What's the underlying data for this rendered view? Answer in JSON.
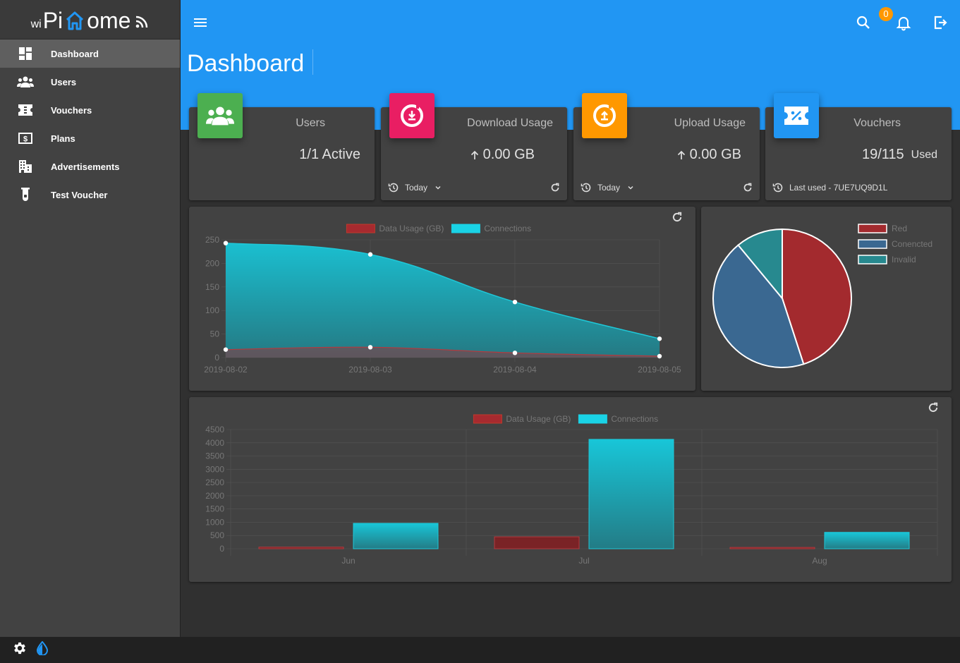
{
  "brand": {
    "wi": "wi",
    "pi": "Pi",
    "home_rest": "ome"
  },
  "colors": {
    "header": "#2196f3",
    "users": "#4caf50",
    "download": "#e91e63",
    "upload": "#ff9800",
    "vouchers": "#2196f3",
    "red": "#a72a2f",
    "teal": "#1fc8d8",
    "blue": "#3a6891",
    "invalid": "#2a9a9e"
  },
  "sidebar": {
    "items": [
      {
        "label": "Dashboard",
        "icon": "dashboard-icon"
      },
      {
        "label": "Users",
        "icon": "users-icon"
      },
      {
        "label": "Vouchers",
        "icon": "ticket-icon"
      },
      {
        "label": "Plans",
        "icon": "dollar-icon"
      },
      {
        "label": "Advertisements",
        "icon": "building-icon"
      },
      {
        "label": "Test Voucher",
        "icon": "test-tube-icon"
      }
    ]
  },
  "header": {
    "title": "Dashboard",
    "notification_count": "0"
  },
  "cards": {
    "users": {
      "title": "Users",
      "value": "1/1 Active"
    },
    "download": {
      "title": "Download Usage",
      "value": "0.00 GB",
      "period": "Today"
    },
    "upload": {
      "title": "Upload Usage",
      "value": "0.00 GB",
      "period": "Today"
    },
    "vouchers": {
      "title": "Vouchers",
      "value": "19/115",
      "suffix": "Used",
      "last_used": "Last used - 7UE7UQ9D1L"
    }
  },
  "chart_data": [
    {
      "type": "area",
      "x": [
        "2019-08-02",
        "2019-08-03",
        "2019-08-04",
        "2019-08-05"
      ],
      "series": [
        {
          "name": "Data Usage (GB)",
          "values": [
            17,
            22,
            10,
            3
          ]
        },
        {
          "name": "Connections",
          "values": [
            243,
            219,
            118,
            40
          ]
        }
      ],
      "ylim": [
        0,
        250
      ],
      "yticks": [
        0,
        50,
        100,
        150,
        200,
        250
      ],
      "grid": true,
      "legend": "top"
    },
    {
      "type": "pie",
      "labels": [
        "Red",
        "Conencted",
        "Invalid"
      ],
      "values": [
        45,
        44,
        11
      ],
      "legend": "top-right"
    },
    {
      "type": "bar",
      "categories": [
        "Jun",
        "Jul",
        "Aug"
      ],
      "series": [
        {
          "name": "Data Usage (GB)",
          "values": [
            60,
            450,
            50
          ]
        },
        {
          "name": "Connections",
          "values": [
            960,
            4130,
            620
          ]
        }
      ],
      "ylim": [
        0,
        4500
      ],
      "yticks": [
        0,
        500,
        1000,
        1500,
        2000,
        2500,
        3000,
        3500,
        4000,
        4500
      ],
      "grid": true,
      "legend": "top"
    }
  ]
}
